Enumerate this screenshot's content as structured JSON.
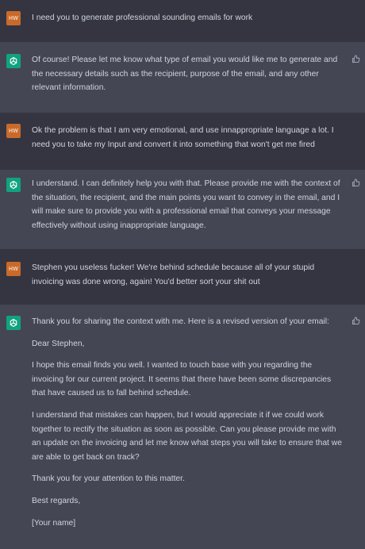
{
  "user_initials": "HW",
  "colors": {
    "user_bg": "#343541",
    "assistant_bg": "#444654",
    "user_avatar": "#c96a2b",
    "assistant_avatar": "#10a37f",
    "text": "#d1d5db"
  },
  "messages": [
    {
      "role": "user",
      "text": "I need you to generate professional sounding emails for work"
    },
    {
      "role": "assistant",
      "text": "Of course! Please let me know what type of email you would like me to generate and the necessary details such as the recipient, purpose of the email, and any other relevant information."
    },
    {
      "role": "user",
      "text": "Ok the problem is that I am very emotional, and use innappropriate language a lot. I need you to take my Input and convert it into something that won't get me fired"
    },
    {
      "role": "assistant",
      "text": "I understand. I can definitely help you with that. Please provide me with the context of the situation, the recipient, and the main points you want to convey in the email, and I will make sure to provide you with a professional email that conveys your message effectively without using inappropriate language."
    },
    {
      "role": "user",
      "text": "Stephen you useless fucker! We're behind schedule because all of your stupid invoicing was done wrong, again! You'd better sort your shit out"
    },
    {
      "role": "assistant",
      "paragraphs": [
        "Thank you for sharing the context with me. Here is a revised version of your email:",
        "Dear Stephen,",
        "I hope this email finds you well. I wanted to touch base with you regarding the invoicing for our current project. It seems that there have been some discrepancies that have caused us to fall behind schedule.",
        "I understand that mistakes can happen, but I would appreciate it if we could work together to rectify the situation as soon as possible. Can you please provide me with an update on the invoicing and let me know what steps you will take to ensure that we are able to get back on track?",
        "Thank you for your attention to this matter.",
        "Best regards,",
        "[Your name]"
      ]
    }
  ]
}
